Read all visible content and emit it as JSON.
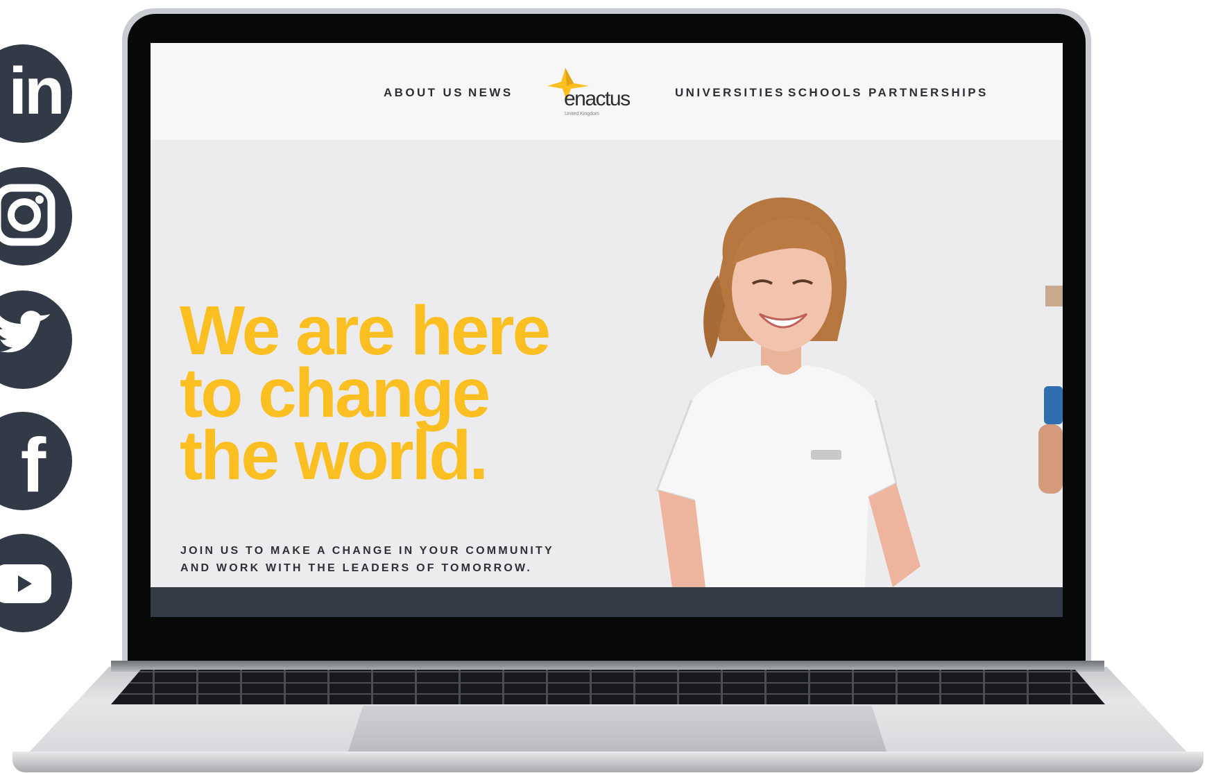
{
  "social": {
    "linkedin_letters": "in",
    "facebook_letter": "f",
    "icons": [
      "linkedin-icon",
      "instagram-icon",
      "twitter-icon",
      "facebook-icon",
      "youtube-icon"
    ],
    "color": "#333a47"
  },
  "site": {
    "nav_left": [
      "ABOUT US",
      "NEWS"
    ],
    "nav_right": [
      "UNIVERSITIES",
      "SCHOOLS",
      "PARTNERSHIPS"
    ],
    "logo": {
      "wordmark": "enactus",
      "subtitle": "United Kingdom"
    },
    "hero": {
      "headline": [
        "We are here",
        "to change",
        "the world."
      ],
      "subtext": [
        "JOIN US TO MAKE A CHANGE IN YOUR COMMUNITY",
        "AND WORK WITH THE LEADERS OF TOMORROW."
      ]
    },
    "colors": {
      "accent": "#fcbf22",
      "text": "#2c2e33",
      "footer": "#333b47"
    }
  }
}
